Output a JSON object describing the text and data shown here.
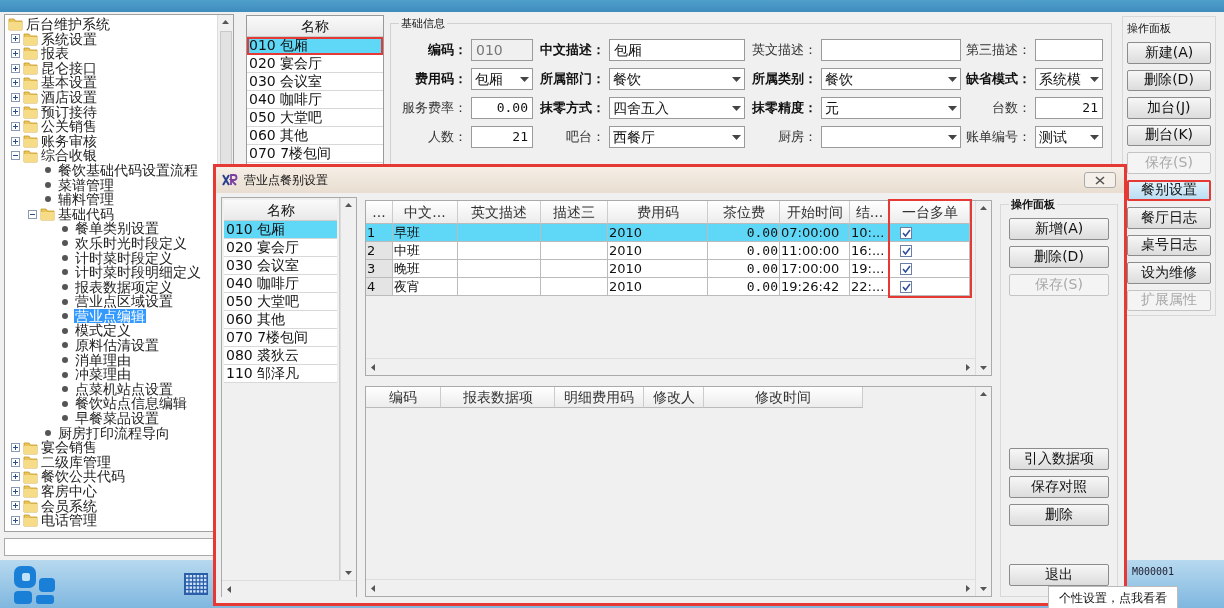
{
  "tree": [
    {
      "label": "后台维护系统",
      "kind": "folder",
      "selected": false,
      "children": [
        {
          "label": "系统设置",
          "kind": "folder",
          "expanded": false,
          "selected": false
        },
        {
          "label": "报表",
          "kind": "folder",
          "expanded": false,
          "selected": false
        },
        {
          "label": "昆仑接口",
          "kind": "folder",
          "expanded": false,
          "selected": false
        },
        {
          "label": "基本设置",
          "kind": "folder",
          "expanded": false,
          "selected": false
        },
        {
          "label": "酒店设置",
          "kind": "folder",
          "expanded": false,
          "selected": false
        },
        {
          "label": "预订接待",
          "kind": "folder",
          "expanded": false,
          "selected": false
        },
        {
          "label": "公关销售",
          "kind": "folder",
          "expanded": false,
          "selected": false
        },
        {
          "label": "账务审核",
          "kind": "folder",
          "expanded": false,
          "selected": false
        },
        {
          "label": "综合收银",
          "kind": "folder",
          "expanded": true,
          "selected": false,
          "children": [
            {
              "label": "餐饮基础代码设置流程",
              "kind": "leaf",
              "selected": false
            },
            {
              "label": "菜谱管理",
              "kind": "leaf",
              "selected": false
            },
            {
              "label": "辅料管理",
              "kind": "leaf",
              "selected": false
            },
            {
              "label": "基础代码",
              "kind": "folder",
              "expanded": true,
              "selected": false,
              "children": [
                {
                  "label": "餐单类别设置",
                  "kind": "leaf",
                  "selected": false
                },
                {
                  "label": "欢乐时光时段定义",
                  "kind": "leaf",
                  "selected": false
                },
                {
                  "label": "计时菜时段定义",
                  "kind": "leaf",
                  "selected": false
                },
                {
                  "label": "计时菜时段明细定义",
                  "kind": "leaf",
                  "selected": false
                },
                {
                  "label": "报表数据项定义",
                  "kind": "leaf",
                  "selected": false
                },
                {
                  "label": "营业点区域设置",
                  "kind": "leaf",
                  "selected": false
                },
                {
                  "label": "营业点编辑",
                  "kind": "leaf",
                  "selected": true
                },
                {
                  "label": "模式定义",
                  "kind": "leaf",
                  "selected": false
                },
                {
                  "label": "原料估清设置",
                  "kind": "leaf",
                  "selected": false
                },
                {
                  "label": "消单理由",
                  "kind": "leaf",
                  "selected": false
                },
                {
                  "label": "冲菜理由",
                  "kind": "leaf",
                  "selected": false
                },
                {
                  "label": "点菜机站点设置",
                  "kind": "leaf",
                  "selected": false
                },
                {
                  "label": "餐饮站点信息编辑",
                  "kind": "leaf",
                  "selected": false
                },
                {
                  "label": "早餐菜品设置",
                  "kind": "leaf",
                  "selected": false
                }
              ]
            },
            {
              "label": "厨房打印流程导向",
              "kind": "leaf",
              "selected": false
            }
          ]
        },
        {
          "label": "宴会销售",
          "kind": "folder",
          "expanded": false,
          "selected": false
        },
        {
          "label": "二级库管理",
          "kind": "folder",
          "expanded": false,
          "selected": false
        },
        {
          "label": "餐饮公共代码",
          "kind": "folder",
          "expanded": false,
          "selected": false
        },
        {
          "label": "客房中心",
          "kind": "folder",
          "expanded": false,
          "selected": false
        },
        {
          "label": "会员系统",
          "kind": "folder",
          "expanded": false,
          "selected": false
        },
        {
          "label": "电话管理",
          "kind": "folder",
          "expanded": false,
          "selected": false
        }
      ]
    }
  ],
  "outlet_list": {
    "header": "名称",
    "items": [
      {
        "label": "010 包厢",
        "selected": true,
        "highlighted": true
      },
      {
        "label": "020 宴会厅",
        "selected": false,
        "highlighted": false
      },
      {
        "label": "030 会议室",
        "selected": false,
        "highlighted": false
      },
      {
        "label": "040 咖啡厅",
        "selected": false,
        "highlighted": false
      },
      {
        "label": "050 大堂吧",
        "selected": false,
        "highlighted": false
      },
      {
        "label": "060 其他",
        "selected": false,
        "highlighted": false
      },
      {
        "label": "070 7楼包间",
        "selected": false,
        "highlighted": false
      }
    ]
  },
  "basic_info": {
    "title": "基础信息",
    "rows": [
      [
        {
          "label": "编码：",
          "required": true,
          "kind": "text",
          "value": "010",
          "disabled": true
        },
        {
          "label": "中文描述：",
          "required": true,
          "kind": "text",
          "value": "包厢",
          "disabled": false
        },
        {
          "label": "英文描述：",
          "required": false,
          "kind": "text",
          "disabled": false
        },
        {
          "label": "第三描述：",
          "required": false,
          "kind": "text",
          "disabled": false
        }
      ],
      [
        {
          "label": "费用码：",
          "required": true,
          "kind": "select",
          "value": "包厢",
          "disabled": false
        },
        {
          "label": "所属部门：",
          "required": true,
          "kind": "select",
          "value": "餐饮",
          "disabled": false
        },
        {
          "label": "所属类别：",
          "required": true,
          "kind": "select",
          "value": "餐饮",
          "disabled": false
        },
        {
          "label": "缺省模式：",
          "required": true,
          "kind": "select",
          "value": "系统模",
          "disabled": false
        }
      ],
      [
        {
          "label": "服务费率：",
          "required": false,
          "kind": "number",
          "value": "0.00",
          "disabled": false
        },
        {
          "label": "抹零方式：",
          "required": true,
          "kind": "select",
          "value": "四舍五入",
          "disabled": false
        },
        {
          "label": "抹零精度：",
          "required": true,
          "kind": "select",
          "value": "元",
          "disabled": false
        },
        {
          "label": "台数：",
          "required": false,
          "kind": "number",
          "value": "21",
          "disabled": false
        }
      ],
      [
        {
          "label": "人数：",
          "required": false,
          "kind": "number",
          "value": "21",
          "disabled": false
        },
        {
          "label": "吧台：",
          "required": false,
          "kind": "select",
          "value": "西餐厅",
          "disabled": false
        },
        {
          "label": "厨房：",
          "required": false,
          "kind": "select",
          "disabled": false
        },
        {
          "label": "账单编号：",
          "required": false,
          "kind": "select",
          "value": "测试",
          "disabled": false
        }
      ]
    ]
  },
  "operation_panel": {
    "title": "操作面板",
    "buttons": [
      {
        "label": "新建(A)",
        "disabled": false,
        "active": false,
        "highlighted": false
      },
      {
        "label": "删除(D)",
        "disabled": false,
        "active": false,
        "highlighted": false
      },
      {
        "label": "加台(J)",
        "disabled": false,
        "active": false,
        "highlighted": false
      },
      {
        "label": "删台(K)",
        "disabled": false,
        "active": false,
        "highlighted": false
      },
      {
        "label": "保存(S)",
        "disabled": true,
        "active": false,
        "highlighted": false
      },
      {
        "label": "餐别设置",
        "disabled": false,
        "active": true,
        "highlighted": true
      },
      {
        "label": "餐厅日志",
        "disabled": false,
        "active": false,
        "highlighted": false
      },
      {
        "label": "桌号日志",
        "disabled": false,
        "active": false,
        "highlighted": false
      },
      {
        "label": "设为维修",
        "disabled": false,
        "active": false,
        "highlighted": false
      },
      {
        "label": "扩展属性",
        "disabled": true,
        "active": false,
        "highlighted": false
      }
    ]
  },
  "dialog": {
    "title": "营业点餐别设置",
    "highlighted": true,
    "outlet_list": {
      "header": "名称",
      "items": [
        {
          "label": "010 包厢",
          "selected": true
        },
        {
          "label": "020 宴会厅",
          "selected": false
        },
        {
          "label": "030 会议室",
          "selected": false
        },
        {
          "label": "040 咖啡厅",
          "selected": false
        },
        {
          "label": "050 大堂吧",
          "selected": false
        },
        {
          "label": "060 其他",
          "selected": false
        },
        {
          "label": "070 7楼包间",
          "selected": false
        },
        {
          "label": "080 裘狄云",
          "selected": false
        },
        {
          "label": "110 邹泽凡",
          "selected": false
        }
      ]
    },
    "meal_table": {
      "columns": [
        {
          "label": "...",
          "highlighted": false
        },
        {
          "label": "中文...",
          "highlighted": false
        },
        {
          "label": "英文描述",
          "highlighted": false
        },
        {
          "label": "描述三",
          "highlighted": false
        },
        {
          "label": "费用码",
          "highlighted": false
        },
        {
          "label": "茶位费",
          "highlighted": false
        },
        {
          "label": "开始时间",
          "highlighted": false
        },
        {
          "label": "结...",
          "highlighted": false
        },
        {
          "label": "一台多单",
          "highlighted": true
        }
      ],
      "rows": [
        {
          "no": "1",
          "name": "早班",
          "fee_code": "2010",
          "tea_fee": "0.00",
          "start": "07:00:00",
          "end": "10:...",
          "multi_order": true,
          "selected": true
        },
        {
          "no": "2",
          "name": "中班",
          "fee_code": "2010",
          "tea_fee": "0.00",
          "start": "11:00:00",
          "end": "16:...",
          "multi_order": true,
          "selected": false
        },
        {
          "no": "3",
          "name": "晚班",
          "fee_code": "2010",
          "tea_fee": "0.00",
          "start": "17:00:00",
          "end": "19:...",
          "multi_order": true,
          "selected": false
        },
        {
          "no": "4",
          "name": "夜宵",
          "fee_code": "2010",
          "tea_fee": "0.00",
          "start": "19:26:42",
          "end": "22:...",
          "multi_order": true,
          "selected": false
        }
      ]
    },
    "mapping_table": {
      "columns": [
        "编码",
        "报表数据项",
        "明细费用码",
        "修改人",
        "修改时间"
      ]
    },
    "panel": {
      "title": "操作面板",
      "button_groups": [
        [
          {
            "label": "新增(A)",
            "disabled": false
          },
          {
            "label": "删除(D)",
            "disabled": false
          },
          {
            "label": "保存(S)",
            "disabled": true
          }
        ],
        [
          {
            "label": "引入数据项",
            "disabled": false
          },
          {
            "label": "保存对照",
            "disabled": false
          },
          {
            "label": "删除",
            "disabled": false
          }
        ],
        [
          {
            "label": "退出",
            "disabled": false
          }
        ]
      ]
    }
  },
  "status": {
    "user_code": "M000001",
    "tooltip": "个性设置，点我看看"
  }
}
